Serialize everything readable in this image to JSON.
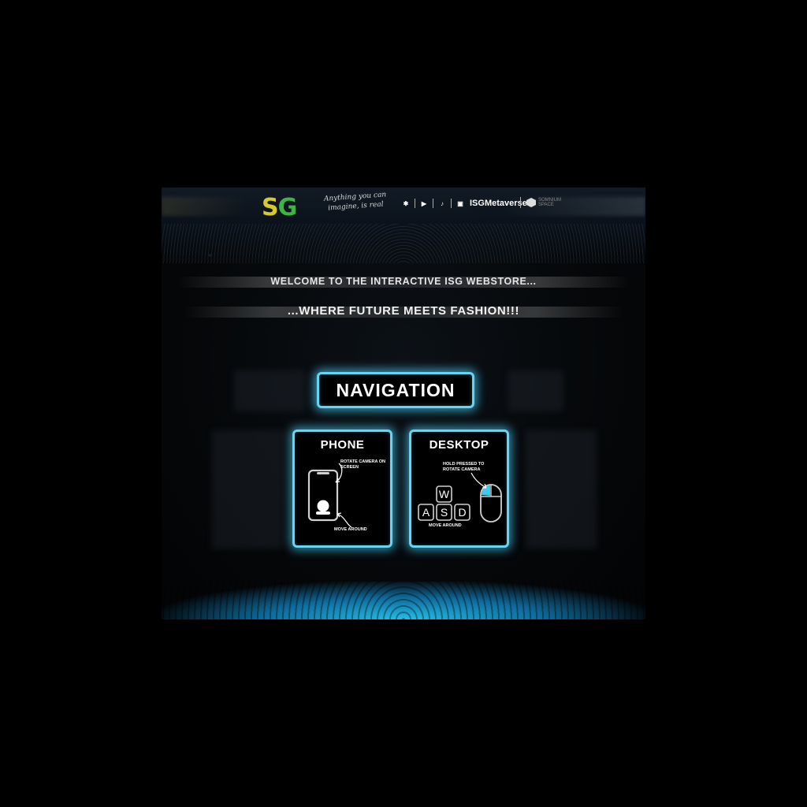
{
  "header": {
    "logo_s": "S",
    "logo_g": "G",
    "tagline": "Anything you can imagine, is real",
    "handle": "ISGMetaverse",
    "partner": "SOMNIUM SPACE",
    "social_icons": [
      "twitter-icon",
      "youtube-icon",
      "tiktok-icon",
      "instagram-icon"
    ]
  },
  "welcome": {
    "line1": "WELCOME TO THE INTERACTIVE ISG WEBSTORE...",
    "line2": "...WHERE FUTURE MEETS FASHION!!!"
  },
  "navigation": {
    "title": "NAVIGATION",
    "phone": {
      "title": "PHONE",
      "rotate_label": "ROTATE CAMERA ON SCREEN",
      "move_label": "MOVE AROUND"
    },
    "desktop": {
      "title": "DESKTOP",
      "rotate_label": "HOLD PRESSED TO ROTATE CAMERA",
      "move_label": "MOVE AROUND",
      "keys": [
        "W",
        "A",
        "S",
        "D"
      ]
    }
  },
  "colors": {
    "accent": "#69d4f2",
    "logo_yellow": "#d6c92a",
    "logo_green": "#3fb443",
    "background": "#000000"
  }
}
